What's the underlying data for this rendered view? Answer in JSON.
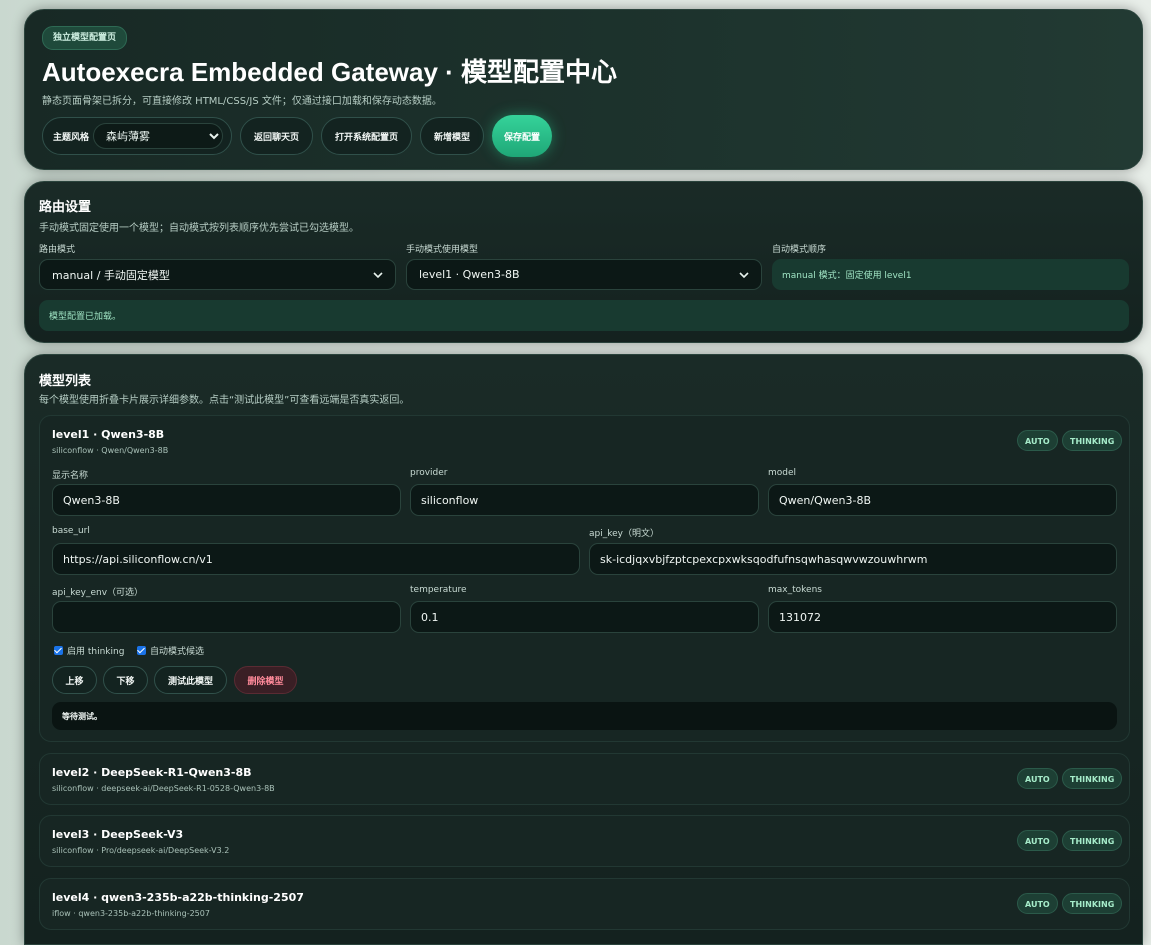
{
  "hero": {
    "badge": "独立模型配置页",
    "title": "Autoexecra Embedded Gateway · 模型配置中心",
    "subtitle": "静态页面骨架已拆分，可直接修改 HTML/CSS/JS 文件；仅通过接口加载和保存动态数据。",
    "theme_label": "主题风格",
    "theme_value": "森屿薄雾",
    "buttons": {
      "back_chat": "返回聊天页",
      "open_system": "打开系统配置页",
      "add_model": "新增模型",
      "save": "保存配置"
    }
  },
  "routing": {
    "title": "路由设置",
    "desc": "手动模式固定使用一个模型；自动模式按列表顺序优先尝试已勾选模型。",
    "mode_label": "路由模式",
    "mode_value": "manual / 手动固定模型",
    "manual_label": "手动模式使用模型",
    "manual_value": "level1 · Qwen3-8B",
    "auto_label": "自动模式顺序",
    "auto_value": "manual 模式：固定使用 level1",
    "status": "模型配置已加载。"
  },
  "models": {
    "title": "模型列表",
    "desc": "每个模型使用折叠卡片展示详细参数。点击“测试此模型”可查看远端是否真实返回。",
    "tag_auto": "AUTO",
    "tag_thinking": "THINKING",
    "expanded": {
      "title": "level1 · Qwen3-8B",
      "sub": "siliconflow · Qwen/Qwen3-8B",
      "labels": {
        "display_name": "显示名称",
        "provider": "provider",
        "model": "model",
        "base_url": "base_url",
        "api_key": "api_key（明文）",
        "api_key_env": "api_key_env（可选）",
        "temperature": "temperature",
        "max_tokens": "max_tokens"
      },
      "values": {
        "display_name": "Qwen3-8B",
        "provider": "siliconflow",
        "model": "Qwen/Qwen3-8B",
        "base_url": "https://api.siliconflow.cn/v1",
        "api_key": "sk-icdjqxvbjfzptcpexcpxwksqodfufnsqwhasqwvwzouwhrwm",
        "api_key_env": "",
        "temperature": "0.1",
        "max_tokens": "131072"
      },
      "check_thinking": "启用 thinking",
      "check_auto": "自动模式候选",
      "btn_up": "上移",
      "btn_down": "下移",
      "btn_test": "测试此模型",
      "btn_delete": "删除模型",
      "result": "等待测试。"
    },
    "collapsed": [
      {
        "title": "level2 · DeepSeek-R1-Qwen3-8B",
        "sub": "siliconflow · deepseek-ai/DeepSeek-R1-0528-Qwen3-8B"
      },
      {
        "title": "level3 · DeepSeek-V3",
        "sub": "siliconflow · Pro/deepseek-ai/DeepSeek-V3.2"
      },
      {
        "title": "level4 · qwen3-235b-a22b-thinking-2507",
        "sub": "iflow · qwen3-235b-a22b-thinking-2507"
      }
    ]
  },
  "colors": {
    "accent": "#2bc489",
    "panel": "#172623",
    "danger": "#ff8a9a"
  }
}
